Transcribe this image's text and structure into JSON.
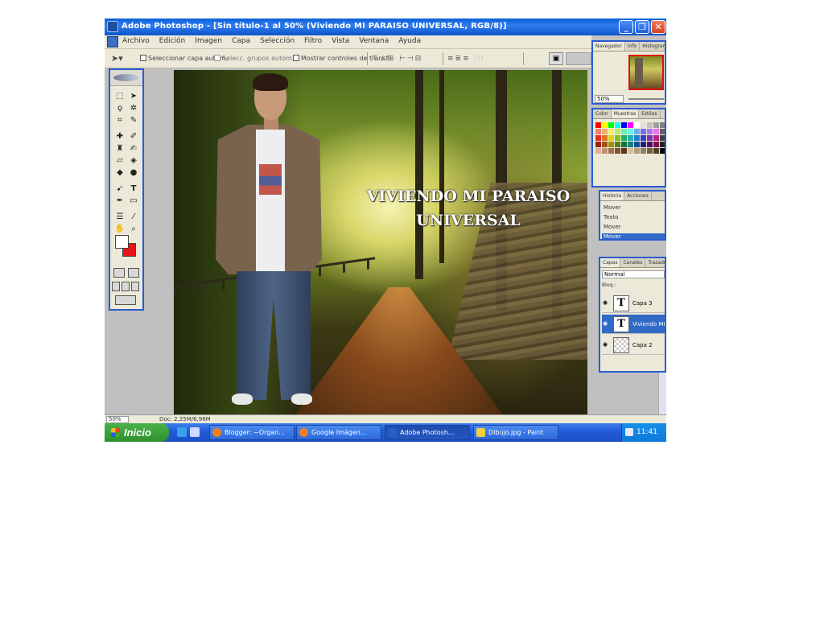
{
  "window": {
    "title": "Adobe Photoshop - [Sin título-1 al 50% (Viviendo MI PARAISO UNIVERSAL, RGB/8)]",
    "minimize": "_",
    "maximize": "❐",
    "close": "✕"
  },
  "menu": [
    "Archivo",
    "Edición",
    "Imagen",
    "Capa",
    "Selección",
    "Filtro",
    "Vista",
    "Ventana",
    "Ayuda"
  ],
  "options_bar": {
    "tool_icon": "move-tool-icon",
    "auto_select_layer": "Seleccionar capa autom.",
    "auto_select_groups": "Selecc. grupos autom.",
    "show_bounding_box": "Mostrar controles de transf."
  },
  "canvas": {
    "caption": "VIVIENDO MI PARAISO\nUNIVERSAL"
  },
  "status_bar": {
    "zoom": "50%",
    "document": "Doc: 2,25M/6,96M"
  },
  "panels": {
    "navigator": {
      "tabs": [
        "Navegador",
        "Info",
        "Histograma"
      ],
      "zoom": "50%"
    },
    "swatches": {
      "tabs": [
        "Color",
        "Muestras",
        "Estilos"
      ],
      "colors": [
        "#ff0000",
        "#ffff00",
        "#00ff00",
        "#00ffff",
        "#0000ff",
        "#ff00ff",
        "#ffffff",
        "#e0e0e0",
        "#c0c0c0",
        "#a0a0a0",
        "#808080",
        "#f08070",
        "#f0b070",
        "#f0f070",
        "#b0f070",
        "#70f0b0",
        "#70f0f0",
        "#70b0f0",
        "#7070f0",
        "#b070f0",
        "#f070f0",
        "#606060",
        "#e03020",
        "#e07020",
        "#e0d020",
        "#80c020",
        "#20b060",
        "#20b0b0",
        "#2080d0",
        "#3040c0",
        "#8030b0",
        "#c02080",
        "#404040",
        "#a02010",
        "#a05010",
        "#a09010",
        "#508010",
        "#107040",
        "#108080",
        "#105090",
        "#202080",
        "#501070",
        "#801050",
        "#202020",
        "#e0b090",
        "#c09070",
        "#a07050",
        "#805030",
        "#603020",
        "#d0c0a0",
        "#b0a080",
        "#908060",
        "#706040",
        "#504020",
        "#000000"
      ]
    },
    "actions": {
      "tabs": [
        "Historia",
        "Acciones"
      ],
      "items": [
        "Mover",
        "Texto",
        "Mover",
        "Mover"
      ]
    },
    "layers": {
      "tabs": [
        "Capas",
        "Canales",
        "Trazados"
      ],
      "blend_mode": "Normal",
      "lock_label": "Bloq.:",
      "items": [
        {
          "name": "Capa 3",
          "thumb": "T"
        },
        {
          "name": "Viviendo MI PARAISO",
          "thumb": "T"
        },
        {
          "name": "Capa 2",
          "thumb": ""
        }
      ]
    }
  },
  "taskbar": {
    "start": "Inicio",
    "tasks": [
      "Blogger: ~Organ...",
      "Google Imágen...",
      "Adobe Photosh...",
      "Dibujo.jpg - Paint"
    ],
    "clock": "11:41"
  }
}
